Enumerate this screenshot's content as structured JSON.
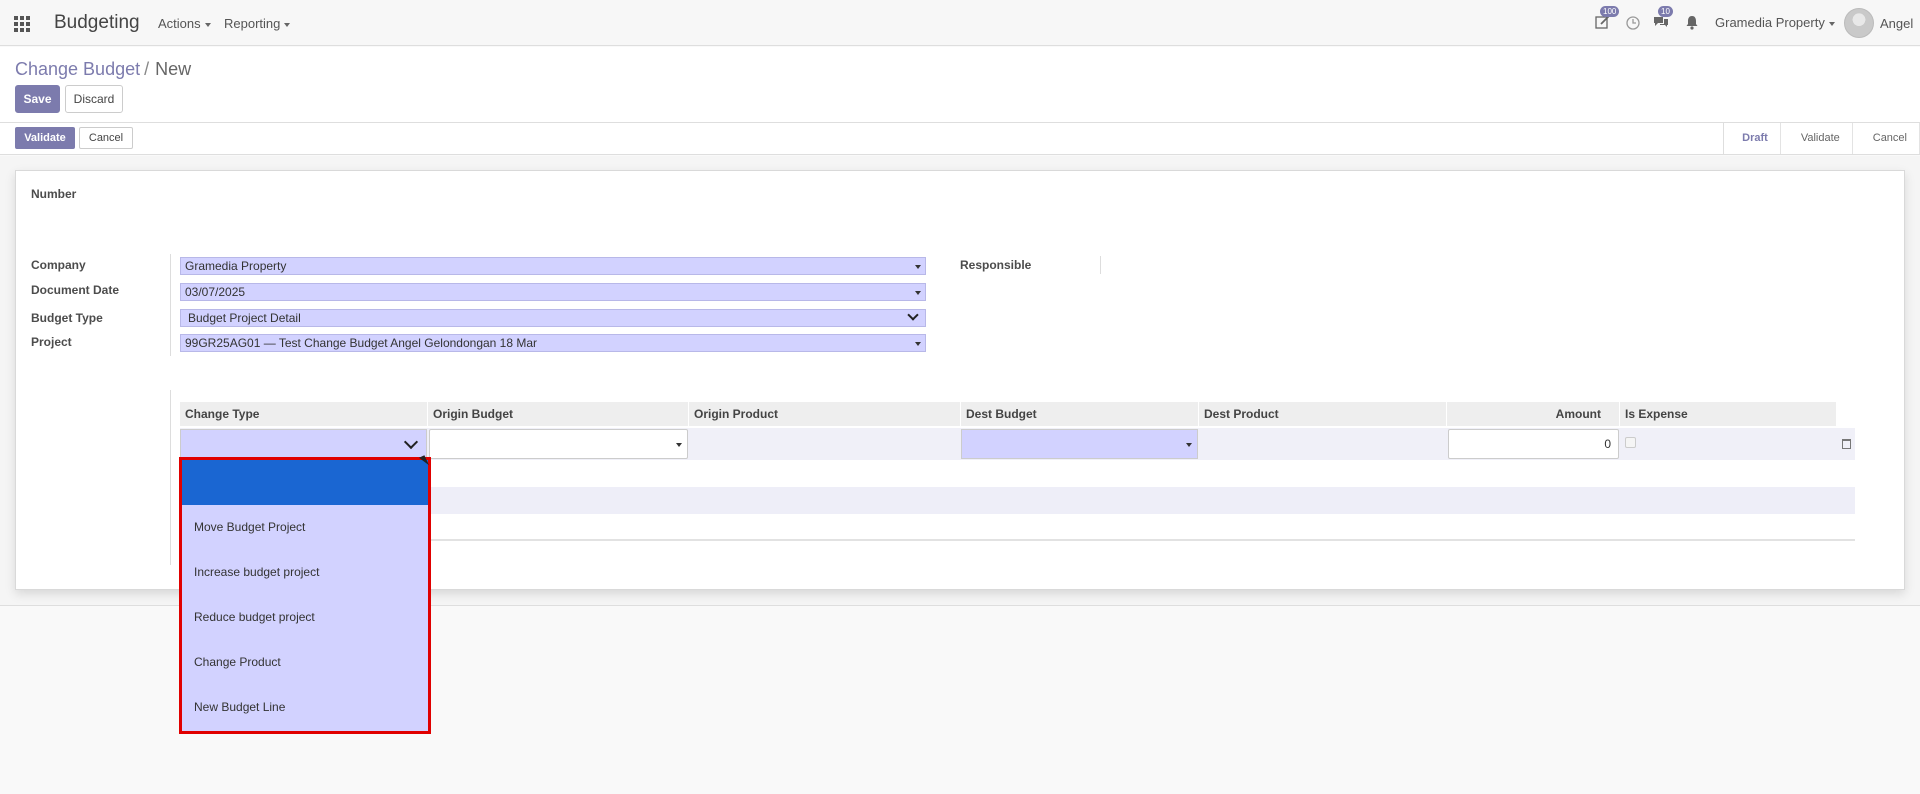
{
  "navbar": {
    "brand": "Budgeting",
    "menus": [
      "Actions",
      "Reporting"
    ],
    "activity_badge": "100",
    "chat_badge": "10",
    "company": "Gramedia Property",
    "user": "Angel"
  },
  "breadcrumb": {
    "parent": "Change Budget",
    "separator": "/",
    "current": "New"
  },
  "control": {
    "save": "Save",
    "discard": "Discard"
  },
  "statusbar": {
    "validate": "Validate",
    "cancel": "Cancel",
    "stages": [
      "Draft",
      "Validate",
      "Cancel"
    ],
    "active_stage": "Draft"
  },
  "form": {
    "number_label": "Number",
    "company_label": "Company",
    "company_value": "Gramedia Property",
    "document_date_label": "Document Date",
    "document_date_value": "03/07/2025",
    "budget_type_label": "Budget Type",
    "budget_type_value": "Budget Project Detail",
    "project_label": "Project",
    "project_value": "99GR25AG01 — Test Change Budget Angel Gelondongan 18 Mar",
    "responsible_label": "Responsible"
  },
  "lines": {
    "columns": [
      "Change Type",
      "Origin Budget",
      "Origin Product",
      "Dest Budget",
      "Dest Product",
      "Amount",
      "Is Expense"
    ],
    "amount_value": "0"
  },
  "change_type_dropdown": {
    "options": [
      "",
      "Move Budget Project",
      "Increase budget project",
      "Reduce budget project",
      "Change Product",
      "New Budget Line"
    ],
    "selected_index": 0,
    "highlight_color": "#e00000"
  },
  "colors": {
    "accent": "#7c7bad",
    "required_field": "#d2d2ff",
    "selected_option": "#1a66d2"
  }
}
